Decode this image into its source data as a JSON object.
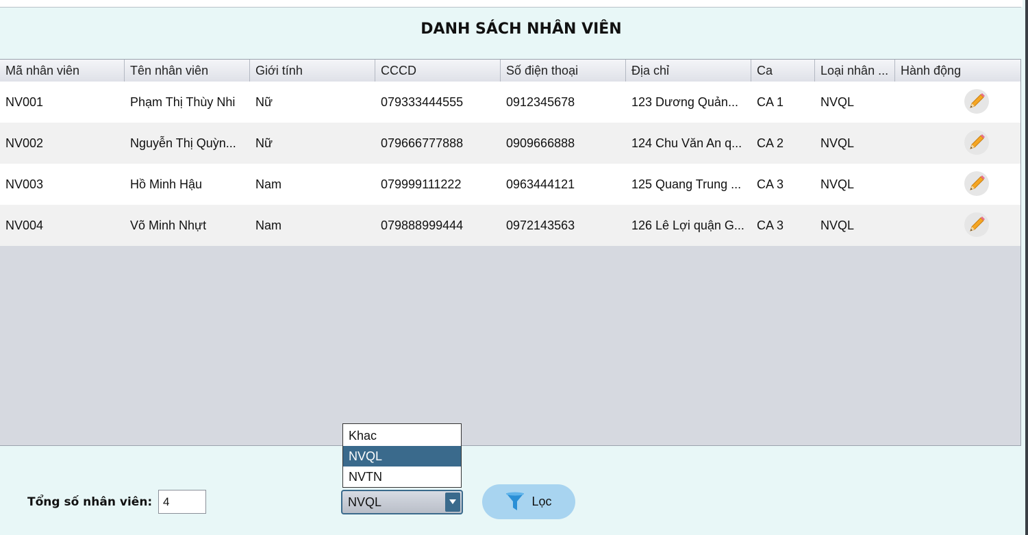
{
  "title": "DANH SÁCH NHÂN VIÊN",
  "table": {
    "columns": [
      "Mã nhân viên",
      "Tên nhân viên",
      "Giới tính",
      "CCCD",
      "Số điện thoại",
      "Địa chỉ",
      "Ca",
      "Loại nhân ...",
      "Hành động"
    ],
    "rows": [
      [
        "NV001",
        "Phạm Thị Thùy Nhi",
        "Nữ",
        "079333444555",
        "0912345678",
        "123 Dương Quản...",
        "CA 1",
        "NVQL"
      ],
      [
        "NV002",
        "Nguyễn Thị Quỳn...",
        "Nữ",
        "079666777888",
        "0909666888",
        "124 Chu Văn An q...",
        "CA 2",
        "NVQL"
      ],
      [
        "NV003",
        "Hồ Minh Hậu",
        "Nam",
        "079999111222",
        "0963444121",
        "125 Quang Trung ...",
        "CA 3",
        "NVQL"
      ],
      [
        "NV004",
        "Võ Minh Nhựt",
        "Nam",
        "079888999444",
        "0972143563",
        "126 Lê Lợi quận G...",
        "CA 3",
        "NVQL"
      ]
    ],
    "action_icon": "pencil-icon"
  },
  "footer": {
    "total_label": "Tổng số nhân viên:",
    "total_value": "4",
    "filter_select": {
      "selected": "NVQL",
      "options": [
        "Khac",
        "NVQL",
        "NVTN"
      ]
    },
    "filter_button_label": "Lọc",
    "filter_icon": "funnel-icon"
  },
  "colors": {
    "background": "#e8f7f7",
    "selected_option": "#3a6a8c",
    "filter_button": "#a8d4f0",
    "pencil": "#f5a623"
  }
}
